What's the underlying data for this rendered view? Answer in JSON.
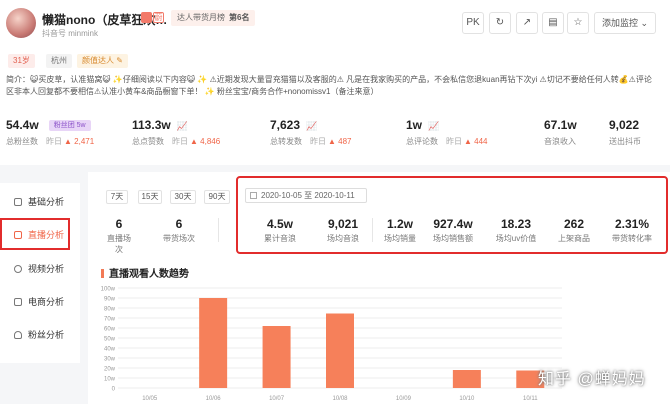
{
  "profile": {
    "name": "懒猫nono（皮草狂欢…",
    "douyin_id": "抖音号 minmink",
    "rank_badge": "达人带货月榜",
    "rank_value": "第6名",
    "name_tag": "蔚",
    "tags": {
      "age": "31岁",
      "city": "杭州",
      "label": "颜值达人 ✎"
    },
    "intro": "简介：😺买皮草，认准猫窝😺 ✨仔细阅读以下内容😺 ✨ ⚠近期发现大量冒充猫猫以及客服的⚠ 凡是在我家购买的产品，不会私信您退kuan再钻下次yi ⚠切记不要给任何人转💰⚠评论区非本人回复都不要相信⚠认准小黄车&商品橱窗下单！ ✨ 粉丝宝宝/商务合作+nonomissv1（备注来意）"
  },
  "top_buttons": {
    "pk": "PK",
    "refresh": "↻",
    "share": "↗",
    "report": "▤",
    "star": "☆",
    "monitor": "添加监控 ⌄"
  },
  "stats": [
    {
      "value": "54.4w",
      "label": "总粉丝数",
      "yesterday": "昨日",
      "change": "▲ 2,471",
      "pill": "粉丝团 5w",
      "mini": ""
    },
    {
      "value": "113.3w",
      "label": "总点赞数",
      "yesterday": "昨日",
      "change": "▲ 4,846",
      "pill": "",
      "mini": "📈"
    },
    {
      "value": "7,623",
      "label": "总转发数",
      "yesterday": "昨日",
      "change": "▲ 487",
      "pill": "",
      "mini": "📈"
    },
    {
      "value": "1w",
      "label": "总评论数",
      "yesterday": "昨日",
      "change": "▲ 444",
      "pill": "",
      "mini": "📈"
    },
    {
      "value": "67.1w",
      "label": "音浪收入",
      "yesterday": "",
      "change": "",
      "pill": "",
      "mini": ""
    },
    {
      "value": "9,022",
      "label": "送出抖币",
      "yesterday": "",
      "change": "",
      "pill": "",
      "mini": ""
    }
  ],
  "sidebar": {
    "items": [
      {
        "label": "基础分析",
        "icon": "doc-icon"
      },
      {
        "label": "直播分析",
        "icon": "live-icon"
      },
      {
        "label": "视频分析",
        "icon": "play-icon"
      },
      {
        "label": "电商分析",
        "icon": "cart-icon"
      },
      {
        "label": "粉丝分析",
        "icon": "user-icon"
      }
    ],
    "active": "直播分析"
  },
  "day_buttons": [
    "7天",
    "15天",
    "30天",
    "90天"
  ],
  "date_range": {
    "start": "2020-10-05",
    "sep": "至",
    "end": "2020-10-11"
  },
  "live_stats": [
    {
      "value": "6",
      "label": "直播场次"
    },
    {
      "value": "6",
      "label": "带货场次"
    },
    {
      "value": "4.5w",
      "label": "累计音浪"
    },
    {
      "value": "9,021",
      "label": "场均音浪"
    },
    {
      "value": "1.2w",
      "label": "场均销量"
    },
    {
      "value": "927.4w",
      "label": "场均销售额"
    },
    {
      "value": "18.23",
      "label": "场均uv价值"
    },
    {
      "value": "262",
      "label": "上架商品"
    },
    {
      "value": "2.31%",
      "label": "带货转化率"
    }
  ],
  "chart_title": "直播观看人数趋势",
  "chart_data": {
    "type": "bar",
    "title": "直播观看人数趋势",
    "categories": [
      "10/05",
      "10/06",
      "10/07",
      "10/08",
      "10/09",
      "10/10",
      "10/11"
    ],
    "values": [
      0,
      900000,
      620000,
      745000,
      0,
      180000,
      175000
    ],
    "yticks": [
      "100w",
      "90w",
      "80w",
      "70w",
      "60w",
      "50w",
      "40w",
      "30w",
      "20w",
      "10w",
      "0"
    ],
    "ylim": [
      0,
      1000000
    ],
    "grid": true,
    "bar_color": "#f6805a"
  },
  "watermark": "知乎 @蝉妈妈"
}
